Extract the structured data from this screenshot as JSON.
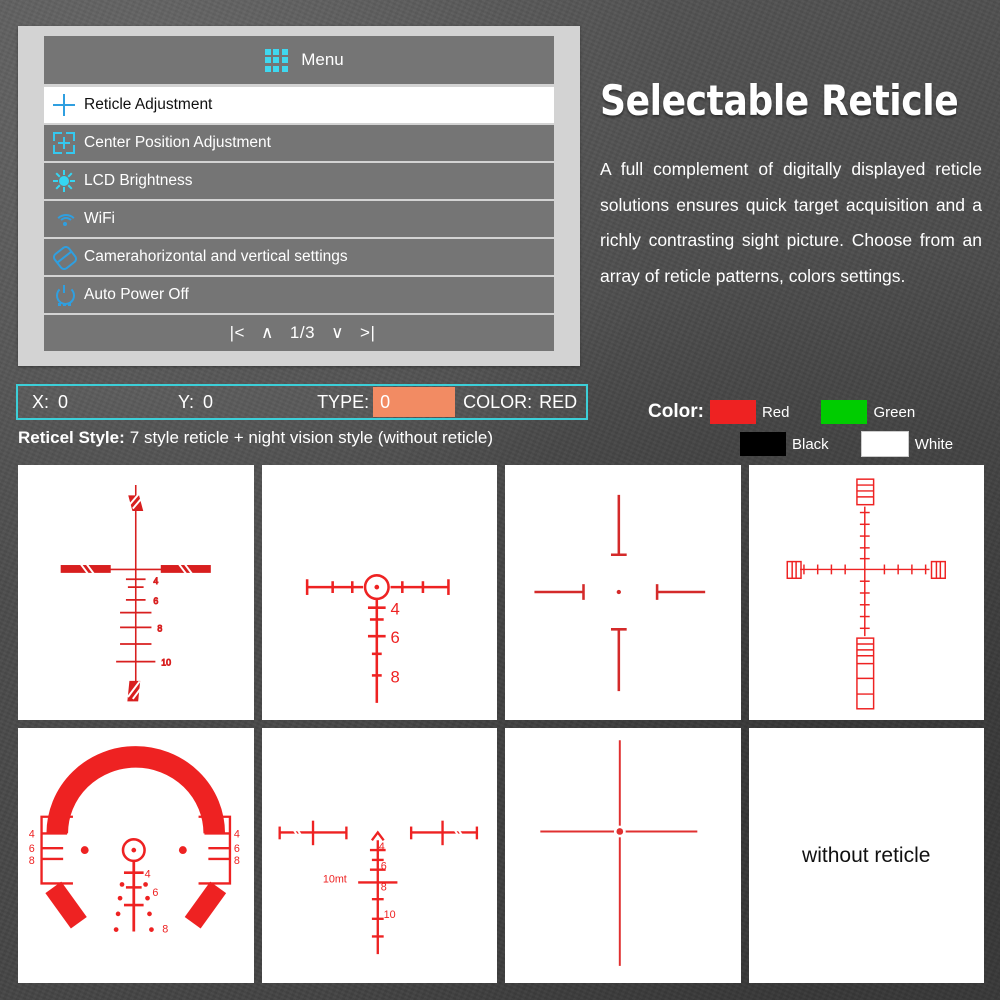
{
  "menu": {
    "header": {
      "title": "Menu",
      "icon": "grid-9-icon"
    },
    "items": [
      {
        "label": "Reticle Adjustment",
        "icon": "crosshair-plus-icon",
        "selected": true
      },
      {
        "label": "Center Position Adjustment",
        "icon": "center-position-icon",
        "selected": false
      },
      {
        "label": "LCD Brightness",
        "icon": "brightness-sun-icon",
        "selected": false
      },
      {
        "label": "WiFi",
        "icon": "wifi-icon",
        "selected": false
      },
      {
        "label": "Camerahorizontal and vertical settings",
        "icon": "camera-tilt-icon",
        "selected": false
      },
      {
        "label": "Auto Power Off",
        "icon": "power-icon",
        "selected": false
      }
    ],
    "pager": {
      "first": "|<",
      "up": "∧",
      "page": "1/3",
      "down": "∨",
      "last": ">|"
    }
  },
  "status_bar": {
    "x_label": "X:",
    "x_value": "0",
    "y_label": "Y:",
    "y_value": "0",
    "type_label": "TYPE:",
    "type_value": "0",
    "color_label": "COLOR:",
    "color_value": "RED",
    "highlight_color": "#f28b63",
    "border_color": "#3ccfd8"
  },
  "reticel_style": {
    "label": "Reticel Style:",
    "value": "7 style reticle + night vision style (without reticle)"
  },
  "headline": "Selectable Reticle",
  "body_copy": "A full complement of digitally displayed reticle solutions ensures quick target acquisition and a richly contrasting sight picture. Choose from an array of reticle patterns, colors settings.",
  "color_legend": {
    "label": "Color:",
    "options": [
      {
        "name": "Red",
        "hex": "#ee2222"
      },
      {
        "name": "Green",
        "hex": "#00cc00"
      },
      {
        "name": "Black",
        "hex": "#000000"
      },
      {
        "name": "White",
        "hex": "#ffffff"
      }
    ]
  },
  "reticles": [
    {
      "id": "duplex-bdc",
      "name": "Duplex crosshair with BDC hash ladder",
      "labels": [
        "4",
        "6",
        "8",
        "10"
      ],
      "color": "#d81f1f"
    },
    {
      "id": "circle-dot-bdc",
      "name": "Circle dot with horizontal bar and BDC post",
      "labels": [
        "4",
        "6",
        "8"
      ],
      "color": "#ee2222"
    },
    {
      "id": "german-four-post",
      "name": "German #4 four post with center dot",
      "labels": [],
      "color": "#d42a2a"
    },
    {
      "id": "mil-dot-ladder",
      "name": "Mil-dot crosshair with rangefinding ladder",
      "labels": [],
      "color": "#ee2222"
    },
    {
      "id": "horseshoe-bracket",
      "name": "Horseshoe with bracket wings and BDC dots",
      "labels": [
        "4",
        "6",
        "8"
      ],
      "color": "#ee2222"
    },
    {
      "id": "chevron-bdc",
      "name": "Chevron tip with BDC ladder",
      "labels": [
        "4",
        "6",
        "8",
        "10"
      ],
      "range_label": "10mt",
      "color": "#ee2222"
    },
    {
      "id": "fine-crosshair-dot",
      "name": "Fine crosshair with center dot",
      "labels": [],
      "color": "#e03030"
    },
    {
      "id": "without-reticle",
      "name": "Night vision style without reticle",
      "text": "without reticle",
      "labels": []
    }
  ]
}
